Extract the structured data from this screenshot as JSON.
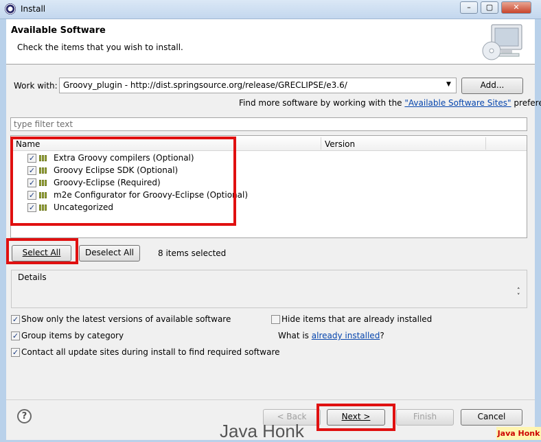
{
  "window": {
    "title": "Install",
    "min": "–",
    "max": "▢",
    "close": "✕"
  },
  "header": {
    "title": "Available Software",
    "subtitle": "Check the items that you wish to install."
  },
  "work_with": {
    "label": "Work with:",
    "value": "Groovy_plugin - http://dist.springsource.org/release/GRECLIPSE/e3.6/",
    "add_label": "Add...",
    "more_prefix": "Find more software by working with the",
    "more_link": "\"Available Software Sites\"",
    "more_suffix": "preferences."
  },
  "filter": {
    "placeholder": "type filter text"
  },
  "tree": {
    "columns": [
      "Name",
      "Version"
    ],
    "items": [
      {
        "label": "Extra Groovy compilers (Optional)",
        "checked": true
      },
      {
        "label": "Groovy Eclipse SDK (Optional)",
        "checked": true
      },
      {
        "label": "Groovy-Eclipse (Required)",
        "checked": true
      },
      {
        "label": "m2e Configurator for Groovy-Eclipse (Optional)",
        "checked": true
      },
      {
        "label": "Uncategorized",
        "checked": true
      }
    ]
  },
  "selection": {
    "select_all": "Select All",
    "deselect_all": "Deselect All",
    "status": "8 items selected"
  },
  "details": {
    "label": "Details"
  },
  "options": {
    "latest": "Show only the latest versions of available software",
    "group": "Group items by category",
    "contact": "Contact all update sites during install to find required software",
    "hide": "Hide items that are already installed",
    "what_is_prefix": "What is",
    "what_is_link": "already installed",
    "what_is_suffix": "?"
  },
  "buttons": {
    "help": "?",
    "back": "< Back",
    "next": "Next >",
    "finish": "Finish",
    "cancel": "Cancel"
  },
  "watermark": {
    "text": "Java Honk",
    "tag": "Java Honk"
  },
  "colors": {
    "highlight": "#e01010",
    "link": "#0645ad"
  }
}
